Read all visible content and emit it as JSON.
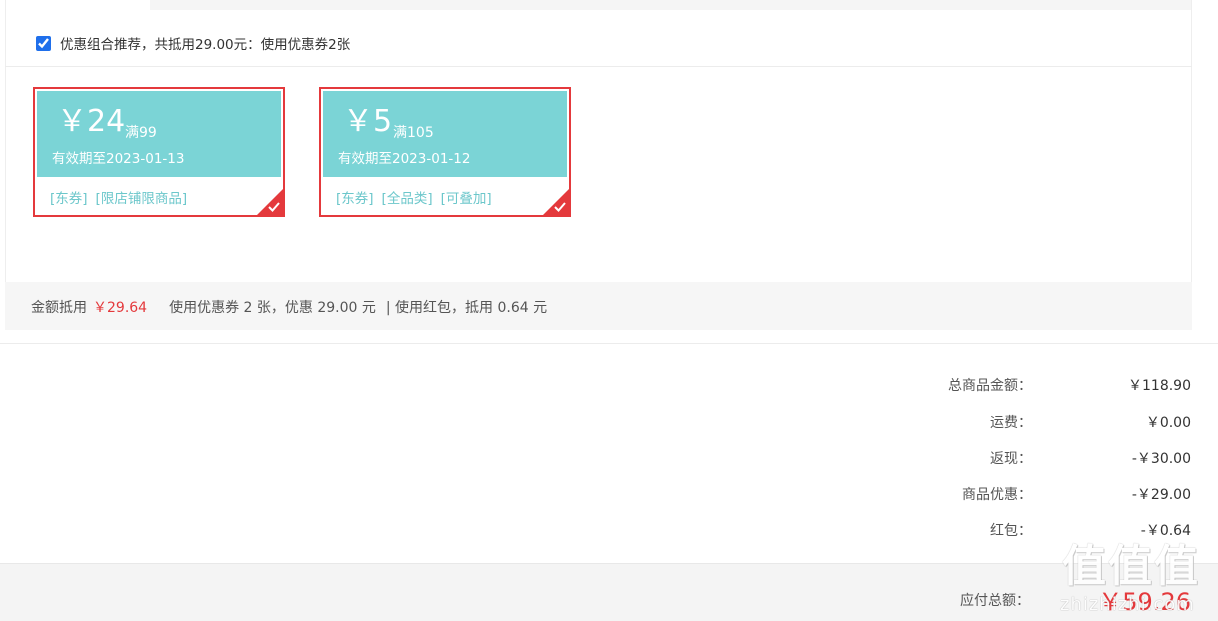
{
  "recommendation": {
    "checked": true,
    "text": "优惠组合推荐，共抵用29.00元：使用优惠券2张"
  },
  "coupons": [
    {
      "amount": "￥24",
      "condition": "满99",
      "valid_until": "有效期至2023-01-13",
      "tags": [
        "[东券]",
        "[限店铺限商品]"
      ],
      "selected": true
    },
    {
      "amount": "￥5",
      "condition": "满105",
      "valid_until": "有效期至2023-01-12",
      "tags": [
        "[东券]",
        "[全品类]",
        "[可叠加]"
      ],
      "selected": true
    }
  ],
  "summary": {
    "label": "金额抵用",
    "amount": "￥29.64",
    "coupon_text": "使用优惠券 2 张，优惠 29.00 元",
    "redpacket_text": "| 使用红包，抵用 0.64 元"
  },
  "totals": [
    {
      "label": "总商品金额：",
      "value": "￥118.90"
    },
    {
      "label": "运费：",
      "value": "￥0.00"
    },
    {
      "label": "返现：",
      "value": "-￥30.00"
    },
    {
      "label": "商品优惠：",
      "value": "-￥29.00"
    },
    {
      "label": "红包：",
      "value": "-￥0.64"
    }
  ],
  "payable": {
    "label": "应付总额：",
    "value": "￥59.26"
  },
  "watermark": {
    "glyphs": "值值值",
    "site": "zhizhizhi.com"
  },
  "colors": {
    "accent": "#e4393c",
    "coupon": "#7bd4d6",
    "tag": "#6cc7cb"
  }
}
